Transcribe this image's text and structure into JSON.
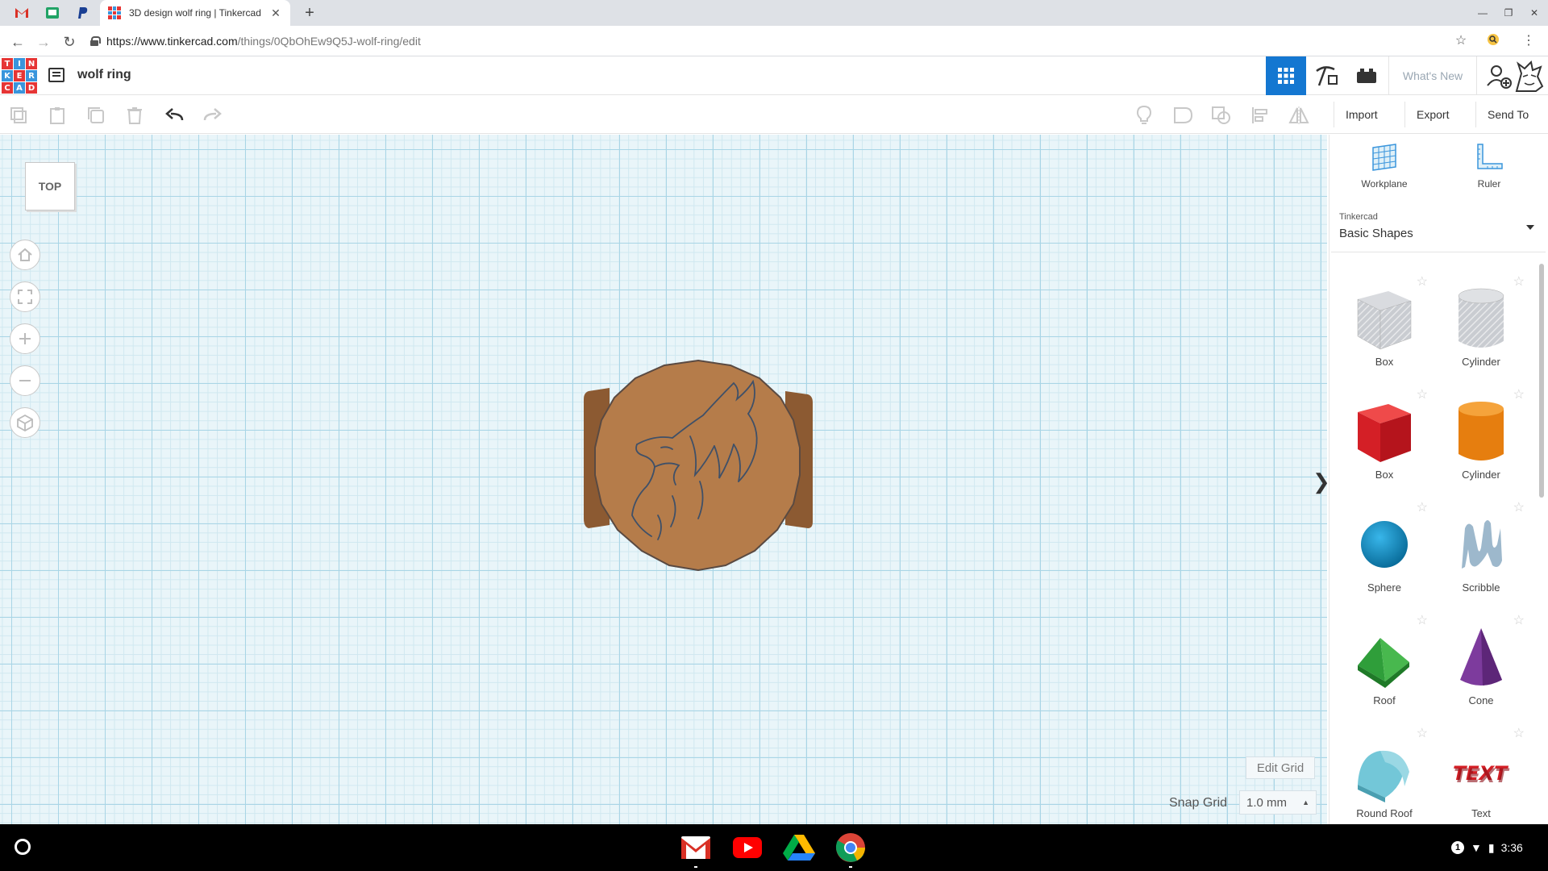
{
  "browser": {
    "active_tab_title": "3D design wolf ring | Tinkercad",
    "url_host": "https://www.tinkercad.com",
    "url_path": "/things/0QbOhEw9Q5J-wolf-ring/edit"
  },
  "tinkercad": {
    "logo_letters": [
      "T",
      "I",
      "N",
      "K",
      "E",
      "R",
      "C",
      "A",
      "D"
    ],
    "logo_colors": [
      "#e63535",
      "#3a95dc",
      "#e63535",
      "#3a95dc",
      "#e63535",
      "#3a95dc",
      "#e63535",
      "#3a95dc",
      "#e63535"
    ],
    "design_title": "wolf ring",
    "whats_new": "What's New",
    "accent": "#1477d1"
  },
  "toolbar": {
    "import": "Import",
    "export": "Export",
    "send_to": "Send To"
  },
  "workspace": {
    "viewcube_face": "TOP",
    "edit_grid": "Edit Grid",
    "snap_grid_label": "Snap Grid",
    "snap_grid_value": "1.0 mm",
    "grid_color": "#a9d5e6",
    "ring_color": "#b57c4a"
  },
  "panel": {
    "workplane": "Workplane",
    "ruler": "Ruler",
    "library_owner": "Tinkercad",
    "library_name": "Basic Shapes",
    "shapes": [
      {
        "name": "Box"
      },
      {
        "name": "Cylinder"
      },
      {
        "name": "Box"
      },
      {
        "name": "Cylinder"
      },
      {
        "name": "Sphere"
      },
      {
        "name": "Scribble"
      },
      {
        "name": "Roof"
      },
      {
        "name": "Cone"
      },
      {
        "name": "Round Roof"
      },
      {
        "name": "Text"
      }
    ]
  },
  "shelf": {
    "time": "3:36",
    "notification_count": "1",
    "apps": [
      "gmail-icon",
      "youtube-icon",
      "drive-icon",
      "chrome-icon"
    ]
  }
}
